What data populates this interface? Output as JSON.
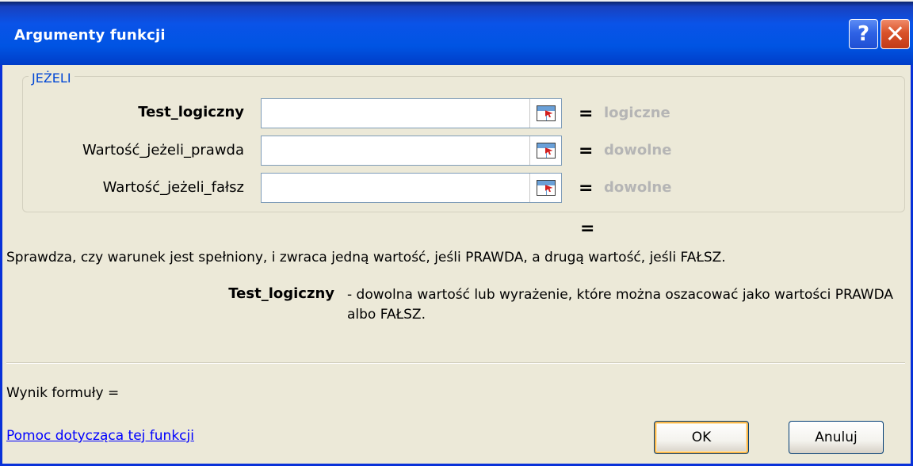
{
  "window": {
    "title": "Argumenty funkcji",
    "help_glyph": "?",
    "close_glyph": "✕"
  },
  "function_group": {
    "name": "JEŻELI",
    "arguments": [
      {
        "label": "Test_logiczny",
        "value": "",
        "equals": "=",
        "type": "logiczne",
        "bold": true
      },
      {
        "label": "Wartość_jeżeli_prawda",
        "value": "",
        "equals": "=",
        "type": "dowolne",
        "bold": false
      },
      {
        "label": "Wartość_jeżeli_fałsz",
        "value": "",
        "equals": "=",
        "type": "dowolne",
        "bold": false
      }
    ]
  },
  "result_equals": "=",
  "description": "Sprawdza, czy warunek jest spełniony, i zwraca jedną wartość, jeśli PRAWDA, a drugą wartość, jeśli FAŁSZ.",
  "argument_help": {
    "name": "Test_logiczny",
    "text": "- dowolna wartość lub wyrażenie, które można oszacować jako wartości PRAWDA albo FAŁSZ."
  },
  "formula_result_label": "Wynik formuły =",
  "help_link": "Pomoc dotycząca tej funkcji",
  "buttons": {
    "ok": "OK",
    "cancel": "Anuluj"
  },
  "icons": {
    "help": "help-icon",
    "close": "close-icon",
    "range_select": "collapse-dialog-icon"
  },
  "colors": {
    "titlebar": "#0054e3",
    "close_button": "#d9532a",
    "group_label": "#0046d5",
    "type_hint": "#b5b5b5",
    "link": "#0000ff"
  }
}
